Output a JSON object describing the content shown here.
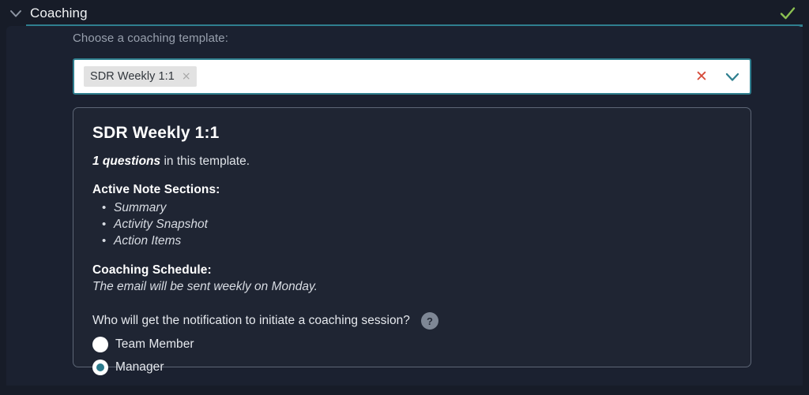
{
  "header": {
    "title": "Coaching",
    "collapse_icon": "chevron-down-icon",
    "status_icon": "check-icon",
    "accent_color": "#2f7f8f",
    "check_color": "#8cc152"
  },
  "form": {
    "template_label": "Choose a coaching template:",
    "combobox": {
      "selected_tags": [
        {
          "label": "SDR Weekly 1:1",
          "remove_icon": "close-icon",
          "remove_glyph": "×"
        }
      ],
      "clear_glyph": "✕",
      "clear_icon": "clear-icon",
      "caret_icon": "chevron-down-icon",
      "clear_color": "#d64b3a",
      "caret_color": "#2f7f8f"
    }
  },
  "template_detail": {
    "title": "SDR Weekly 1:1",
    "questions_count": "1 questions",
    "questions_suffix": " in this template.",
    "sections_heading": "Active Note Sections:",
    "sections": [
      "Summary",
      "Activity Snapshot",
      "Action Items"
    ],
    "schedule_heading": "Coaching Schedule:",
    "schedule_text": "The email will be sent weekly on Monday.",
    "notification_question": "Who will get the notification to initiate a coaching session?",
    "help_glyph": "?",
    "radio_options": [
      {
        "label": "Team Member",
        "selected": false
      },
      {
        "label": "Manager",
        "selected": true
      }
    ]
  }
}
